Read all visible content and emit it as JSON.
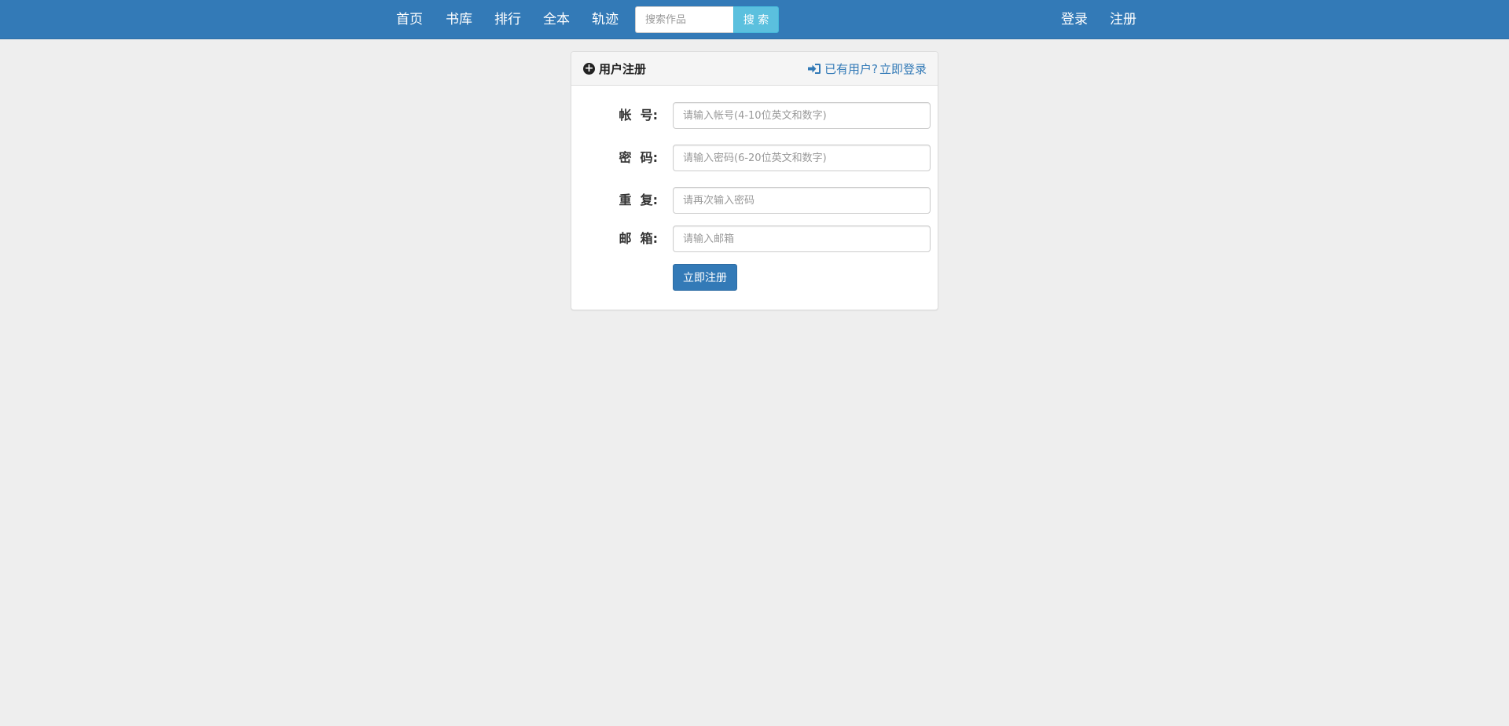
{
  "nav": {
    "links": [
      {
        "label": "首页"
      },
      {
        "label": "书库"
      },
      {
        "label": "排行"
      },
      {
        "label": "全本"
      },
      {
        "label": "轨迹"
      }
    ],
    "search": {
      "placeholder": "搜索作品",
      "value": "",
      "button_label": "搜 索"
    },
    "right_links": [
      {
        "label": "登录"
      },
      {
        "label": "注册"
      }
    ]
  },
  "panel": {
    "title": "用户注册",
    "title_icon": "plus-circle-icon",
    "login_prompt": "已有用户?",
    "login_link": "立即登录",
    "login_icon": "log-in-icon"
  },
  "form": {
    "fields": [
      {
        "label": "帐  号:",
        "placeholder": "请输入帐号(4-10位英文和数字)",
        "value": ""
      },
      {
        "label": "密  码:",
        "placeholder": "请输入密码(6-20位英文和数字)",
        "value": ""
      },
      {
        "label": "重  复:",
        "placeholder": "请再次输入密码",
        "value": ""
      },
      {
        "label": "邮  箱:",
        "placeholder": "请输入邮箱",
        "value": ""
      }
    ],
    "submit_label": "立即注册"
  },
  "colors": {
    "navbar": "#337ab7",
    "page_background": "#eeeeee",
    "search_button": "#5bc0de",
    "primary_button": "#337ab7",
    "link": "#337ab7"
  }
}
